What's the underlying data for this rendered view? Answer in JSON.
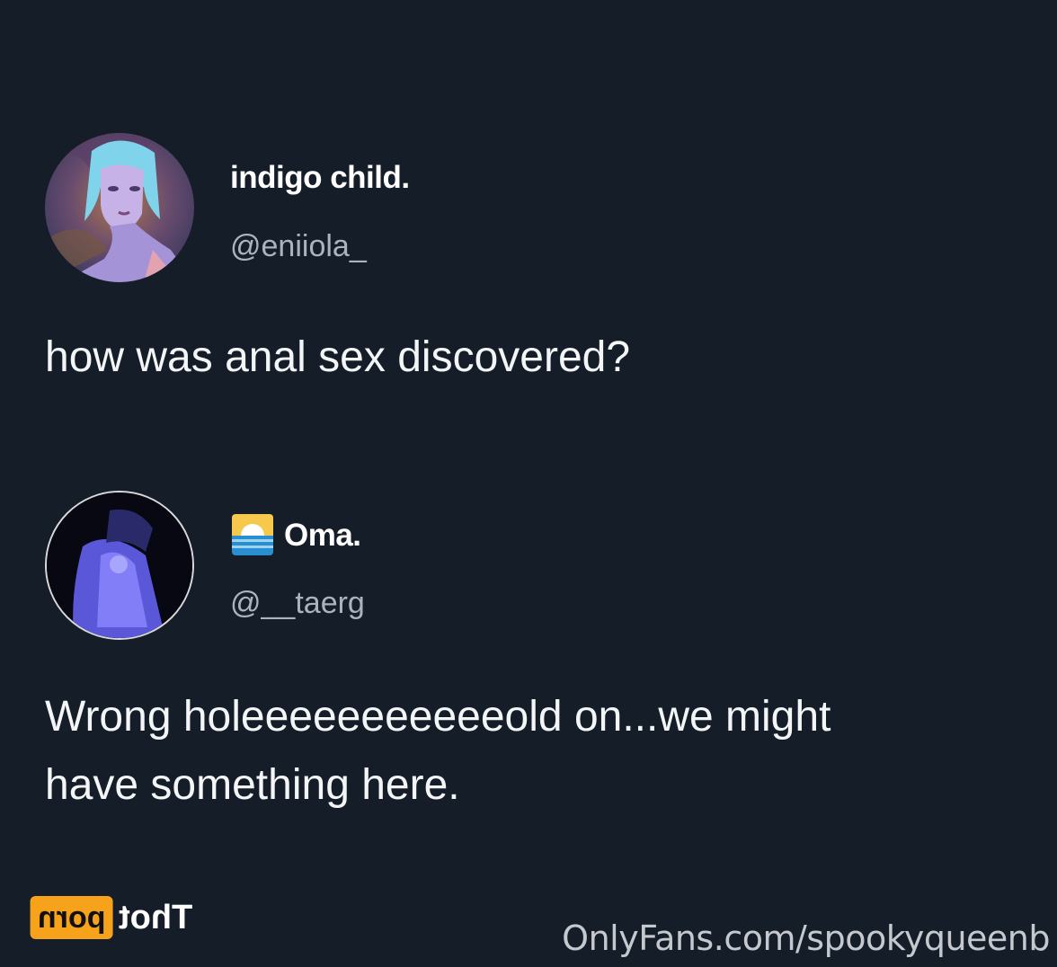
{
  "tweets": [
    {
      "display_name": "indigo child.",
      "handle": "@eniiola_",
      "text_lines": [
        "how was anal sex discovered?"
      ]
    },
    {
      "display_name": "Oma.",
      "handle": "@__taerg",
      "text_lines": [
        "Wrong holeeeeeeeeeeeold on...we might",
        "have something here."
      ]
    }
  ],
  "watermark": {
    "logo_box_text": "porn",
    "logo_text": "Thot",
    "url": "OnlyFans.com/spookyqueenb"
  },
  "colors": {
    "background": "#151d28",
    "text": "#f3f5f7",
    "handle": "#aab4bf",
    "logo_accent": "#f7a21b"
  }
}
